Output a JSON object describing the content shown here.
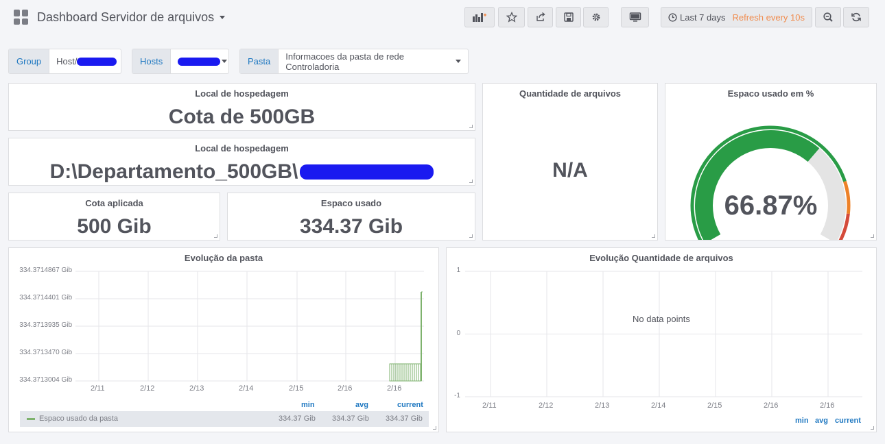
{
  "header": {
    "title": "Dashboard Servidor de arquivos",
    "time_range": "Last 7 days",
    "refresh": "Refresh every 10s"
  },
  "variables": [
    {
      "label": "Group",
      "value": "Host/"
    },
    {
      "label": "Hosts",
      "value": ""
    },
    {
      "label": "Pasta",
      "value": "Informacoes da pasta de rede Controladoria"
    }
  ],
  "panels": {
    "local1": {
      "title": "Local de hospedagem",
      "value": "Cota de 500GB"
    },
    "local2": {
      "title": "Local de hospedagem",
      "value": "D:\\Departamento_500GB\\"
    },
    "cota": {
      "title": "Cota aplicada",
      "value": "500 Gib"
    },
    "espaco": {
      "title": "Espaco usado",
      "value": "334.37 Gib"
    },
    "qtd": {
      "title": "Quantidade de arquivos",
      "value": "N/A"
    },
    "gauge": {
      "title": "Espaco usado em %",
      "value": "66.87%",
      "percent": 66.87,
      "colors": {
        "ok": "#299c46",
        "warn": "#ed8128",
        "crit": "#d44a3a",
        "track": "#e4e4e4"
      }
    }
  },
  "graph1": {
    "title": "Evolução da pasta",
    "y_ticks": [
      "334.3714867 Gib",
      "334.3714401 Gib",
      "334.3713935 Gib",
      "334.3713470 Gib",
      "334.3713004 Gib"
    ],
    "x_ticks": [
      "2/11",
      "2/12",
      "2/13",
      "2/14",
      "2/15",
      "2/16",
      "2/16"
    ],
    "legend_heads": [
      "min",
      "avg",
      "current"
    ],
    "series": {
      "name": "Espaco usado da pasta",
      "min": "334.37 Gib",
      "avg": "334.37 Gib",
      "current": "334.37 Gib",
      "color": "#7eb26d"
    }
  },
  "graph2": {
    "title": "Evolução Quantidade de arquivos",
    "y_ticks": [
      "1",
      "0",
      "-1"
    ],
    "x_ticks": [
      "2/11",
      "2/12",
      "2/13",
      "2/14",
      "2/15",
      "2/16",
      "2/16"
    ],
    "no_data": "No data points",
    "legend_heads": [
      "min",
      "avg",
      "current"
    ]
  }
}
